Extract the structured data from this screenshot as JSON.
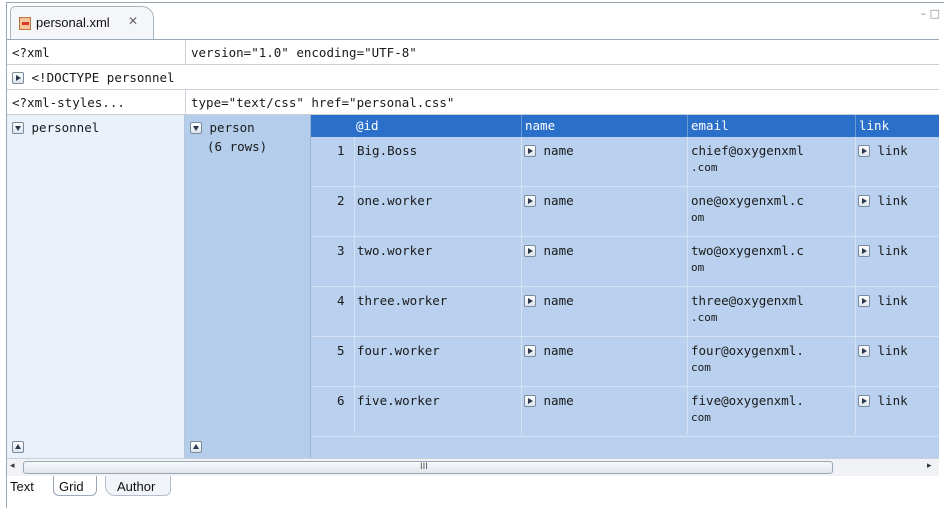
{
  "tab": {
    "title": "personal.xml",
    "close": "✕"
  },
  "window_controls": "– □",
  "prolog": {
    "xml_decl": {
      "name": "<?xml",
      "value": "version=\"1.0\" encoding=\"UTF-8\""
    },
    "doctype": {
      "label": "<!DOCTYPE personnel"
    },
    "stylesheet": {
      "name": "<?xml-styles...",
      "value": "type=\"text/css\" href=\"personal.css\""
    }
  },
  "grid": {
    "root_label": "personnel",
    "child_label": "person",
    "child_rows": "(6 rows)",
    "columns": [
      "@id",
      "name",
      "email",
      "link"
    ],
    "rows": [
      {
        "num": "1",
        "id": "Big.Boss",
        "name": "name",
        "email_1": "chief@oxygenxml",
        "email_2": ".com",
        "link": "link"
      },
      {
        "num": "2",
        "id": "one.worker",
        "name": "name",
        "email_1": "one@oxygenxml.c",
        "email_2": "om",
        "link": "link"
      },
      {
        "num": "3",
        "id": "two.worker",
        "name": "name",
        "email_1": "two@oxygenxml.c",
        "email_2": "om",
        "link": "link"
      },
      {
        "num": "4",
        "id": "three.worker",
        "name": "name",
        "email_1": "three@oxygenxml",
        "email_2": ".com",
        "link": "link"
      },
      {
        "num": "5",
        "id": "four.worker",
        "name": "name",
        "email_1": "four@oxygenxml.",
        "email_2": "com",
        "link": "link"
      },
      {
        "num": "6",
        "id": "five.worker",
        "name": "name",
        "email_1": "five@oxygenxml.",
        "email_2": "com",
        "link": "link"
      }
    ]
  },
  "hscroll": {
    "grip": "III",
    "left": "◂",
    "right": "▸"
  },
  "modes": [
    "Text",
    "Grid",
    "Author"
  ]
}
